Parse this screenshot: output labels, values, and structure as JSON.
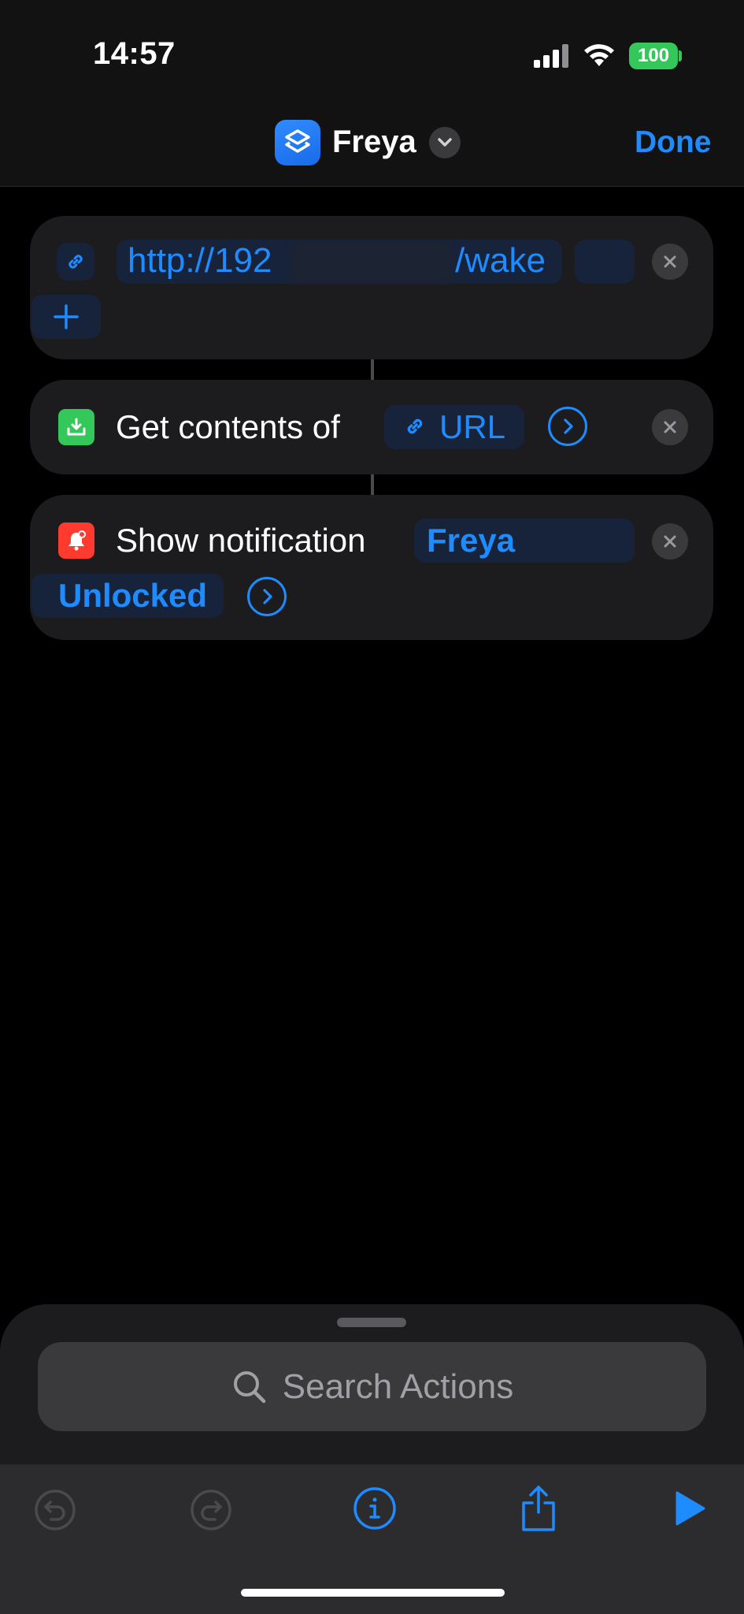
{
  "status_bar": {
    "time": "14:57",
    "battery": "100"
  },
  "nav": {
    "title": "Freya",
    "done_label": "Done"
  },
  "actions": {
    "url": {
      "prefix": "http://192",
      "suffix": "/wake"
    },
    "get_contents": {
      "label": "Get contents of",
      "token": "URL"
    },
    "notification": {
      "label": "Show notification",
      "text_line1": "Freya",
      "text_line2": "Unlocked"
    }
  },
  "search": {
    "placeholder": "Search Actions"
  },
  "icons": {
    "app": "shortcuts-layers-icon",
    "chevron": "chevron-down-icon",
    "link": "link-icon",
    "download": "download-icon",
    "notification": "bell-icon",
    "close": "close-icon",
    "arrow": "chevron-right-circle-icon",
    "add": "plus-icon",
    "search": "search-icon",
    "undo": "undo-icon",
    "redo": "redo-icon",
    "info": "info-icon",
    "share": "share-icon",
    "run": "play-icon"
  },
  "colors": {
    "accent": "#1e8cff",
    "battery": "#34c759",
    "get_contents": "#34c759",
    "notification": "#ff3b30"
  }
}
